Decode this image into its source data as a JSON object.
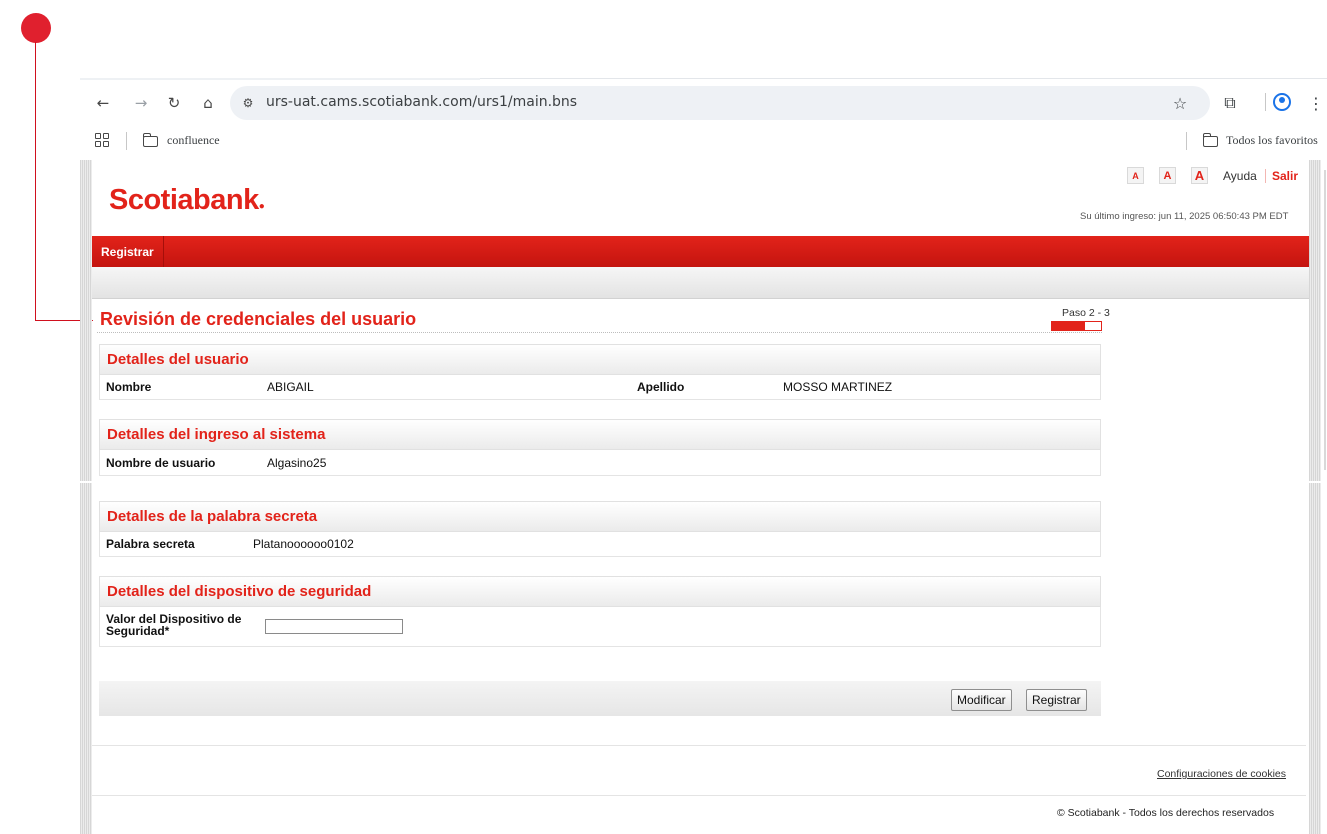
{
  "browser": {
    "url": "urs-uat.cams.scotiabank.com/urs1/main.bns",
    "bookmark_folder": "confluence",
    "all_bookmarks": "Todos los favoritos"
  },
  "header": {
    "logo": "Scotiabank",
    "font_sizes": [
      "A",
      "A",
      "A"
    ],
    "help": "Ayuda",
    "logout": "Salir",
    "last_login": "Su último ingreso: jun 11, 2025 06:50:43 PM EDT"
  },
  "nav": {
    "items": [
      "Registrar"
    ]
  },
  "page": {
    "title": "Revisión de credenciales del usuario",
    "step": "Paso 2 - 3",
    "step_progress": 0.67
  },
  "sections": {
    "user": {
      "title": "Detalles del usuario",
      "first_name_label": "Nombre",
      "first_name": "ABIGAIL",
      "last_name_label": "Apellido",
      "last_name": "MOSSO MARTINEZ"
    },
    "login": {
      "title": "Detalles del ingreso al sistema",
      "username_label": "Nombre de usuario",
      "username": "Algasino25"
    },
    "secret": {
      "title": "Detalles de la palabra secreta",
      "secret_label": "Palabra secreta",
      "secret": "Platanoooooo0102"
    },
    "device": {
      "title": "Detalles del dispositivo de seguridad",
      "value_label_1": "Valor del Dispositivo de",
      "value_label_2": "Seguridad*",
      "value": ""
    }
  },
  "actions": {
    "modify": "Modificar",
    "register": "Registrar"
  },
  "footer": {
    "cookies": "Configuraciones de cookies",
    "copyright": "© Scotiabank - Todos los derechos reservados"
  },
  "colors": {
    "brand_red": "#e2231a",
    "annotation_red": "#e0202e"
  }
}
